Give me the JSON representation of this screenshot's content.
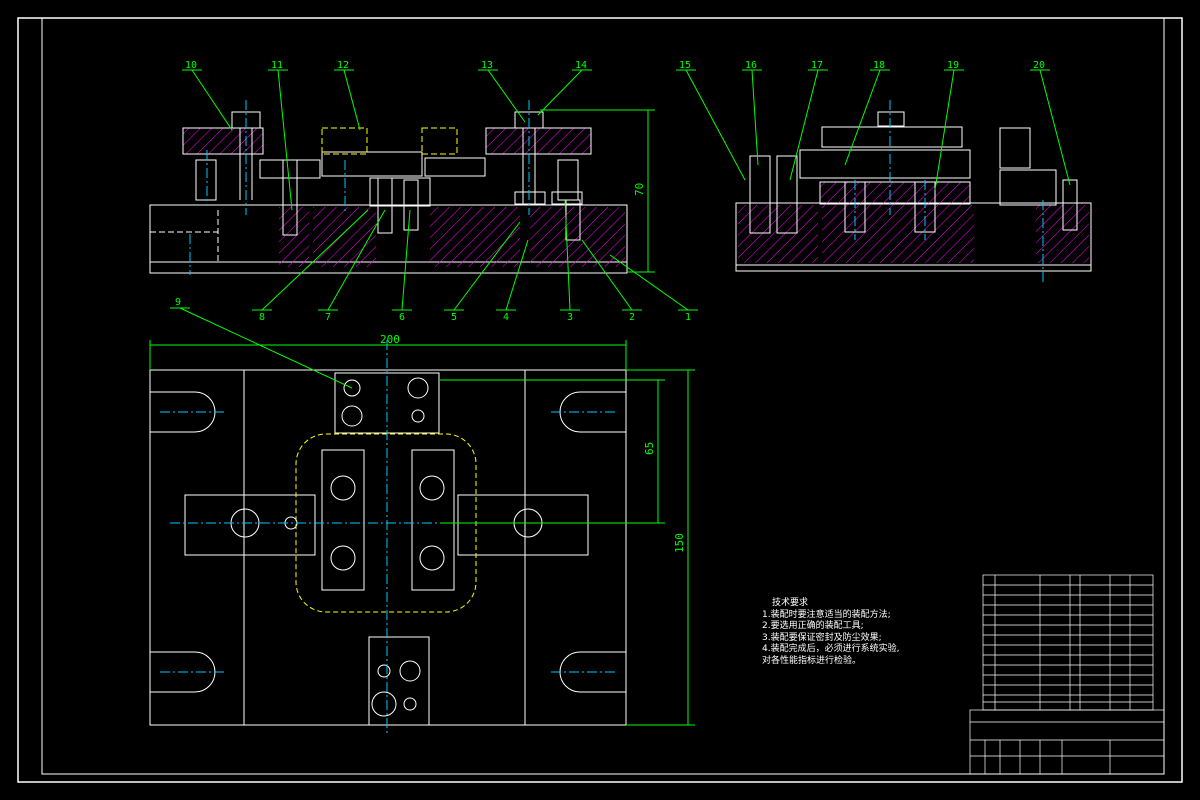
{
  "balloons": [
    "10",
    "11",
    "12",
    "13",
    "14",
    "15",
    "16",
    "17",
    "18",
    "19",
    "20",
    "8",
    "7",
    "6",
    "5",
    "4",
    "3",
    "2",
    "1",
    "9"
  ],
  "dimensions": {
    "height_side": "70",
    "width_plan": "200",
    "offset_plan": "65",
    "height_plan": "150"
  },
  "tech_requirements": {
    "title": "技术要求",
    "lines": [
      "1.装配时要注意适当的装配方法;",
      "2.要选用正确的装配工具;",
      "3.装配要保证密封及防尘效果;",
      "4.装配完成后，必须进行系统实验,",
      "对各性能指标进行检验。"
    ]
  },
  "colors": {
    "background": "#000000",
    "outline": "#ffffff",
    "leader": "#00ff00",
    "centerline": "#00c8ff",
    "hatch": "#ff00ff",
    "hidden": "#ffff00",
    "flange": "#ff00ff"
  }
}
